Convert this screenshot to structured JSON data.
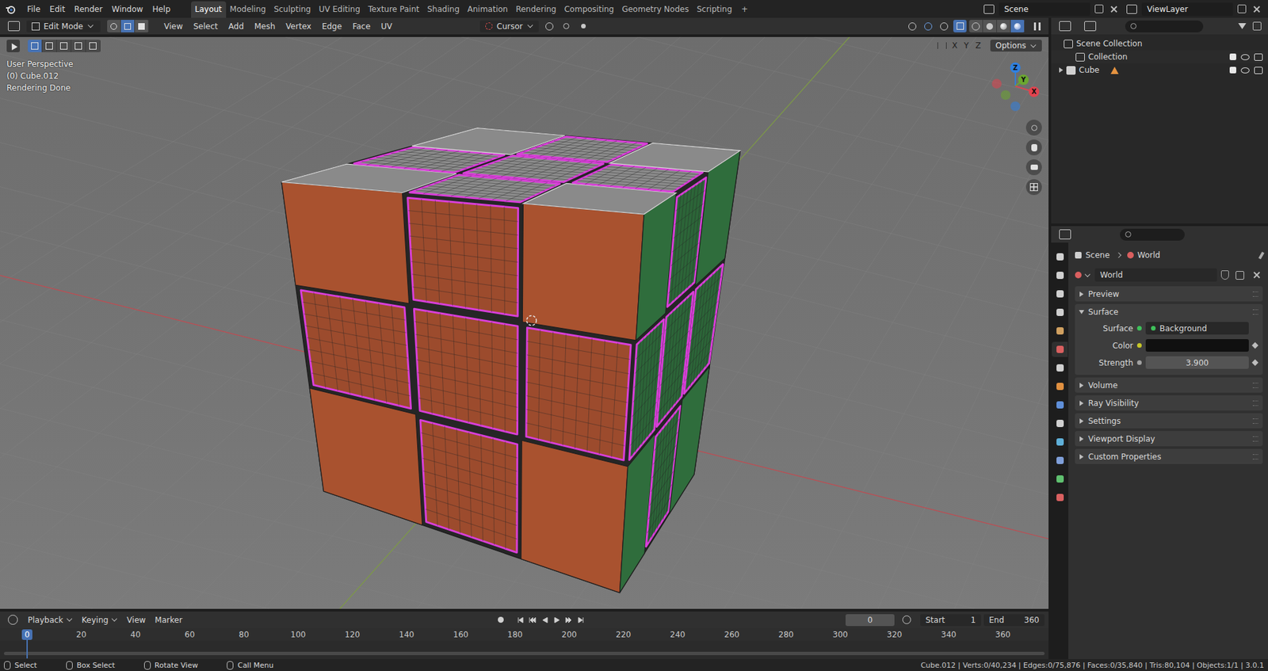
{
  "topbar": {
    "menus": [
      "File",
      "Edit",
      "Render",
      "Window",
      "Help"
    ],
    "workspaces": [
      {
        "label": "Layout",
        "selected": true
      },
      {
        "label": "Modeling",
        "selected": false
      },
      {
        "label": "Sculpting",
        "selected": false
      },
      {
        "label": "UV Editing",
        "selected": false
      },
      {
        "label": "Texture Paint",
        "selected": false
      },
      {
        "label": "Shading",
        "selected": false
      },
      {
        "label": "Animation",
        "selected": false
      },
      {
        "label": "Rendering",
        "selected": false
      },
      {
        "label": "Compositing",
        "selected": false
      },
      {
        "label": "Geometry Nodes",
        "selected": false
      },
      {
        "label": "Scripting",
        "selected": false
      }
    ],
    "add_tab": "+",
    "scene": "Scene",
    "view_layer": "ViewLayer"
  },
  "viewport_header": {
    "mode": "Edit Mode",
    "select_modes": [
      {
        "mode": "vertex",
        "selected": false
      },
      {
        "mode": "edge",
        "selected": true
      },
      {
        "mode": "face",
        "selected": false
      }
    ],
    "menus": [
      "View",
      "Select",
      "Add",
      "Mesh",
      "Vertex",
      "Edge",
      "Face",
      "UV"
    ],
    "pivot": "Cursor",
    "xray": true,
    "shading": [
      {
        "mode": "wireframe",
        "selected": false
      },
      {
        "mode": "solid",
        "selected": false
      },
      {
        "mode": "material",
        "selected": false
      },
      {
        "mode": "rendered",
        "selected": true
      }
    ],
    "axes": [
      "X",
      "Y",
      "Z"
    ],
    "options": "Options"
  },
  "viewport": {
    "overlay": [
      "User Perspective",
      "(0) Cube.012",
      "Rendering Done"
    ],
    "gizmo": [
      {
        "label": "Z",
        "color": "#2f80e0"
      },
      {
        "label": "Y",
        "color": "#6ba630"
      },
      {
        "label": "X",
        "color": "#e0444f"
      }
    ]
  },
  "outliner": {
    "items": [
      {
        "label": "Scene Collection",
        "kind": "root",
        "expanded": true,
        "checked": false
      },
      {
        "label": "Collection",
        "kind": "collection",
        "expanded": true,
        "checked": true
      },
      {
        "label": "Cube",
        "kind": "object",
        "expanded": false,
        "checked": true
      }
    ]
  },
  "properties": {
    "tabs": [
      {
        "selected": false
      },
      {
        "selected": false
      },
      {
        "selected": false
      },
      {
        "selected": false
      },
      {
        "selected": false
      },
      {
        "selected": true
      },
      {
        "selected": false
      },
      {
        "selected": false
      },
      {
        "selected": false
      },
      {
        "selected": false
      },
      {
        "selected": false
      },
      {
        "selected": false
      },
      {
        "selected": false
      },
      {
        "selected": false
      }
    ],
    "breadcrumb": [
      "Scene",
      "World"
    ],
    "datablock": "World",
    "panels": [
      {
        "label": "Preview",
        "expanded": false,
        "fields": []
      },
      {
        "label": "Surface",
        "expanded": true,
        "fields": [
          {
            "label": "Surface",
            "value": "Background",
            "kind": "shader",
            "color": "#3ec05a"
          },
          {
            "label": "Color",
            "value": "",
            "kind": "color",
            "color": "#c7c729"
          },
          {
            "label": "Strength",
            "value": "3.900",
            "kind": "number",
            "color": "#a1a1a1"
          }
        ]
      },
      {
        "label": "Volume",
        "expanded": false,
        "fields": []
      },
      {
        "label": "Ray Visibility",
        "expanded": false,
        "fields": []
      },
      {
        "label": "Settings",
        "expanded": false,
        "fields": []
      },
      {
        "label": "Viewport Display",
        "expanded": false,
        "fields": []
      },
      {
        "label": "Custom Properties",
        "expanded": false,
        "fields": []
      }
    ]
  },
  "timeline": {
    "menus": [
      "Playback",
      "Keying",
      "View",
      "Marker"
    ],
    "current_frame": "0",
    "start_label": "Start",
    "start": "1",
    "end_label": "End",
    "end": "360",
    "ticks": [
      {
        "label": "0",
        "selected": true
      },
      {
        "label": "20",
        "selected": false
      },
      {
        "label": "40",
        "selected": false
      },
      {
        "label": "60",
        "selected": false
      },
      {
        "label": "80",
        "selected": false
      },
      {
        "label": "100",
        "selected": false
      },
      {
        "label": "120",
        "selected": false
      },
      {
        "label": "140",
        "selected": false
      },
      {
        "label": "160",
        "selected": false
      },
      {
        "label": "180",
        "selected": false
      },
      {
        "label": "200",
        "selected": false
      },
      {
        "label": "220",
        "selected": false
      },
      {
        "label": "240",
        "selected": false
      },
      {
        "label": "260",
        "selected": false
      },
      {
        "label": "280",
        "selected": false
      },
      {
        "label": "300",
        "selected": false
      },
      {
        "label": "320",
        "selected": false
      },
      {
        "label": "340",
        "selected": false
      },
      {
        "label": "360",
        "selected": false
      }
    ]
  },
  "status_bar": {
    "hints": [
      "Select",
      "Box Select",
      "Rotate View",
      "Call Menu"
    ],
    "stats": "Cube.012 | Verts:0/40,234 | Edges:0/75,876 | Faces:0/35,840 | Tris:80,104 | Objects:1/1 | 3.0.1"
  }
}
